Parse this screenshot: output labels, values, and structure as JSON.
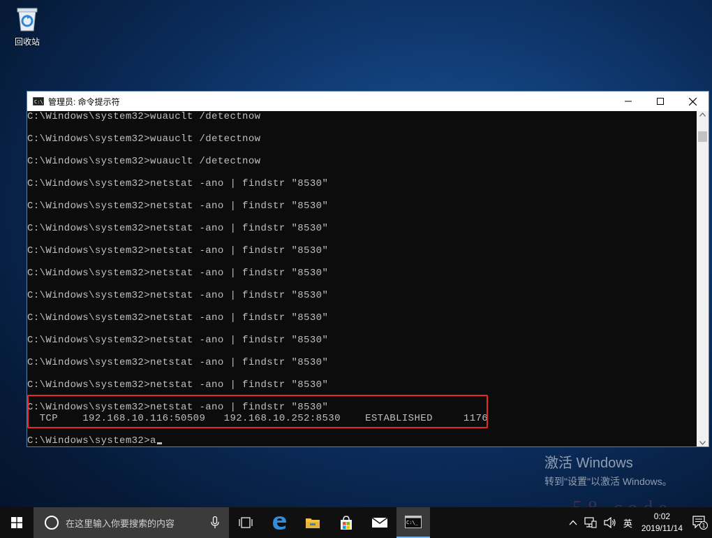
{
  "desktop": {
    "recycle_bin_label": "回收站",
    "icons": [
      "recycle-bin-icon"
    ]
  },
  "window": {
    "title": "管理员: 命令提示符",
    "controls": [
      "minimize-icon",
      "maximize-icon",
      "close-icon"
    ]
  },
  "console": {
    "lines": [
      "C:\\Windows\\system32>wuauclt /detectnow",
      "C:\\Windows\\system32>wuauclt /detectnow",
      "C:\\Windows\\system32>wuauclt /detectnow",
      "C:\\Windows\\system32>netstat -ano | findstr \"8530\"",
      "C:\\Windows\\system32>netstat -ano | findstr \"8530\"",
      "C:\\Windows\\system32>netstat -ano | findstr \"8530\"",
      "C:\\Windows\\system32>netstat -ano | findstr \"8530\"",
      "C:\\Windows\\system32>netstat -ano | findstr \"8530\"",
      "C:\\Windows\\system32>netstat -ano | findstr \"8530\"",
      "C:\\Windows\\system32>netstat -ano | findstr \"8530\"",
      "C:\\Windows\\system32>netstat -ano | findstr \"8530\"",
      "C:\\Windows\\system32>netstat -ano | findstr \"8530\"",
      "C:\\Windows\\system32>netstat -ano | findstr \"8530\"",
      "C:\\Windows\\system32>netstat -ano | findstr \"8530\""
    ],
    "result_line": "  TCP    192.168.10.116:50509   192.168.10.252:8530    ESTABLISHED     1176",
    "prompt_line": "C:\\Windows\\system32>a",
    "highlight_color": "#e8282b",
    "text_color": "#c0c0c0",
    "background": "#0c0c0c"
  },
  "watermark": {
    "line1": "激活 Windows",
    "line2": "转到\"设置\"以激活 Windows。",
    "brand": "58.code"
  },
  "taskbar": {
    "search_placeholder": "在这里输入你要搜索的内容",
    "apps": [
      "start-icon",
      "search-circle-icon",
      "microphone-icon",
      "task-view-icon",
      "edge-icon",
      "file-explorer-icon",
      "store-icon",
      "mail-icon",
      "cmd-icon"
    ],
    "tray": {
      "ime": "英",
      "time": "0:02",
      "date": "2019/11/14",
      "notification_count": "1"
    }
  }
}
